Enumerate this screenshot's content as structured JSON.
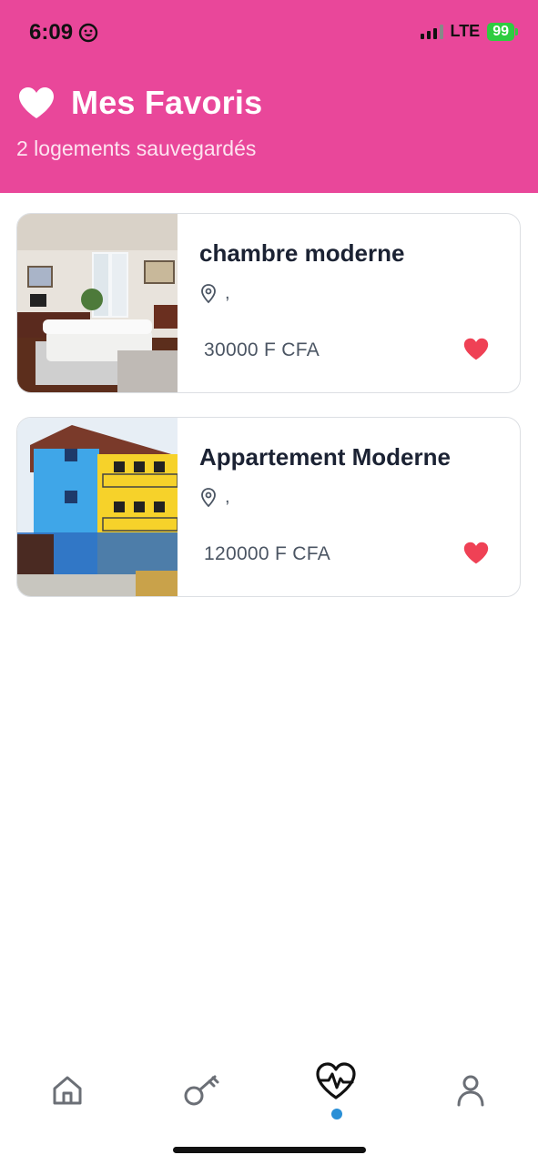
{
  "status": {
    "time": "6:09",
    "network": "LTE",
    "battery": "99"
  },
  "header": {
    "title": "Mes Favoris",
    "subtitle": "2 logements sauvegardés",
    "background": "#e9479a"
  },
  "favorites": [
    {
      "name": "chambre moderne",
      "location": ",",
      "price": "30000 F CFA",
      "favorite": true
    },
    {
      "name": "Appartement Moderne",
      "location": ",",
      "price": "120000 F CFA",
      "favorite": true
    }
  ],
  "nav": {
    "items": [
      "home-icon",
      "key-icon",
      "heart-pulse-icon",
      "user-icon"
    ],
    "active_index": 2,
    "accent": "#2a8fd6"
  }
}
